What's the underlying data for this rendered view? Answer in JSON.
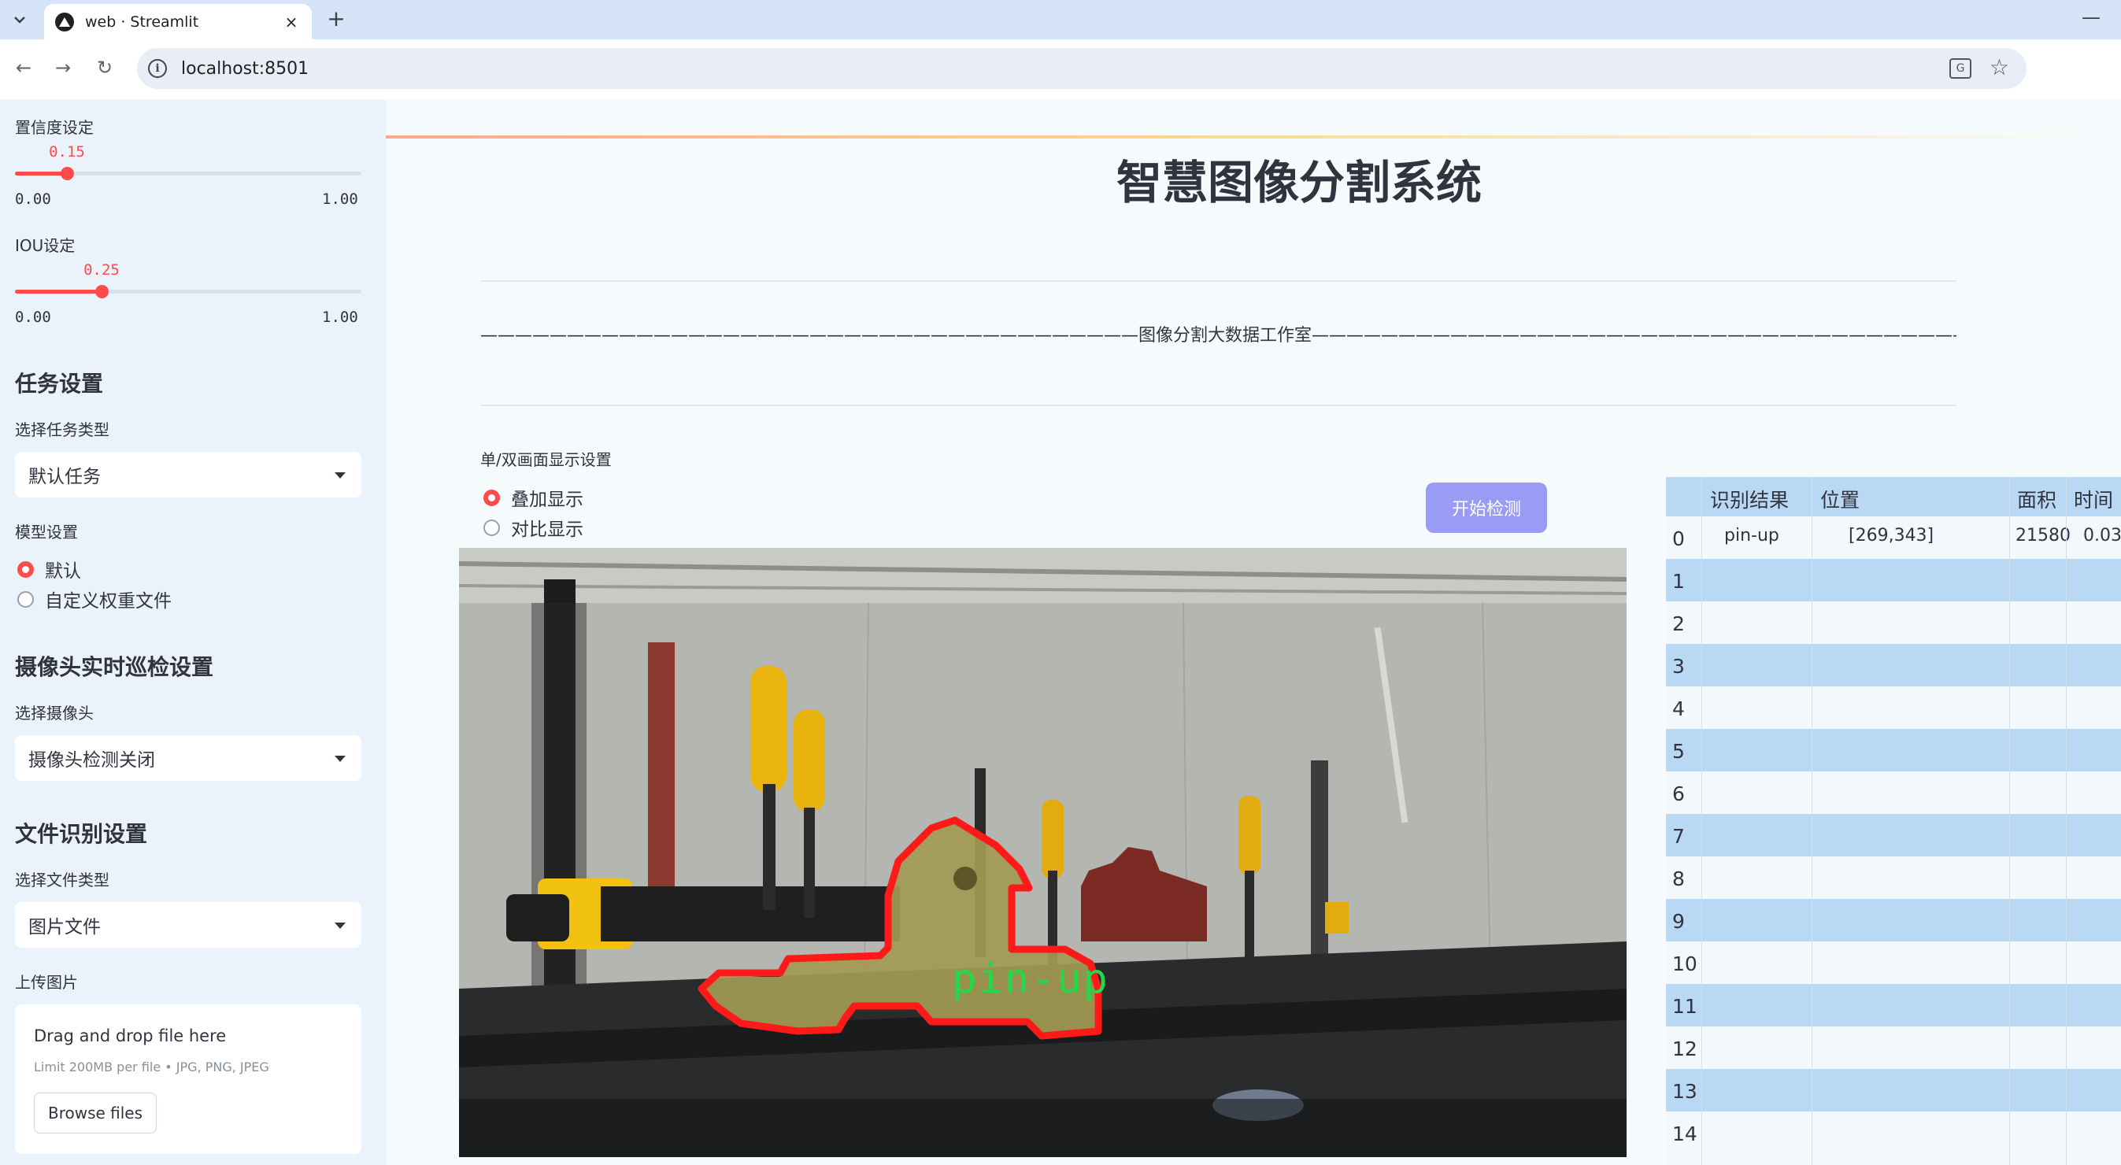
{
  "browser": {
    "tab_title": "web · Streamlit",
    "tab_close": "×",
    "new_tab": "+",
    "url": "localhost:8501",
    "minimize": "—"
  },
  "sidebar": {
    "confidence": {
      "label": "置信度设定",
      "value": "0.15",
      "value_fraction": 0.15,
      "min": "0.00",
      "max": "1.00"
    },
    "iou": {
      "label": "IOU设定",
      "value": "0.25",
      "value_fraction": 0.25,
      "min": "0.00",
      "max": "1.00"
    },
    "task_heading": "任务设置",
    "task_type_label": "选择任务类型",
    "task_type_value": "默认任务",
    "model_label": "模型设置",
    "model_options": [
      "默认",
      "自定义权重文件"
    ],
    "model_selected": "默认",
    "camera_heading": "摄像头实时巡检设置",
    "camera_label": "选择摄像头",
    "camera_value": "摄像头检测关闭",
    "file_heading": "文件识别设置",
    "file_type_label": "选择文件类型",
    "file_type_value": "图片文件",
    "upload_label": "上传图片",
    "upload_drop_text": "Drag and drop file here",
    "upload_limit": "Limit 200MB per file • JPG, PNG, JPEG",
    "browse_button": "Browse files"
  },
  "main": {
    "title": "智慧图像分割系统",
    "studio_line": "——————————————————————————————————————图像分割大数据工作室——————————————————————————————————————",
    "display_mode_label": "单/双画面显示设置",
    "display_options": [
      "叠加显示",
      "对比显示"
    ],
    "display_selected": "叠加显示",
    "start_button": "开始检测",
    "detection_label": "pin-up"
  },
  "results": {
    "columns": [
      "识别结果",
      "位置",
      "面积",
      "时间"
    ],
    "rows": [
      {
        "idx": "0",
        "result": "pin-up",
        "position": "[269,343]",
        "area": "21580",
        "time": "0.03"
      },
      {
        "idx": "1"
      },
      {
        "idx": "2"
      },
      {
        "idx": "3"
      },
      {
        "idx": "4"
      },
      {
        "idx": "5"
      },
      {
        "idx": "6"
      },
      {
        "idx": "7"
      },
      {
        "idx": "8"
      },
      {
        "idx": "9"
      },
      {
        "idx": "10"
      },
      {
        "idx": "11"
      },
      {
        "idx": "12"
      },
      {
        "idx": "13"
      },
      {
        "idx": "14"
      }
    ]
  },
  "colors": {
    "accent": "#ff4b4b",
    "button": "#9a9bf5",
    "sidebar_bg": "#eaf2fb",
    "table_header": "#b9d8f3",
    "mask_outline": "#ff1a1a",
    "label_green": "#25d84a"
  }
}
